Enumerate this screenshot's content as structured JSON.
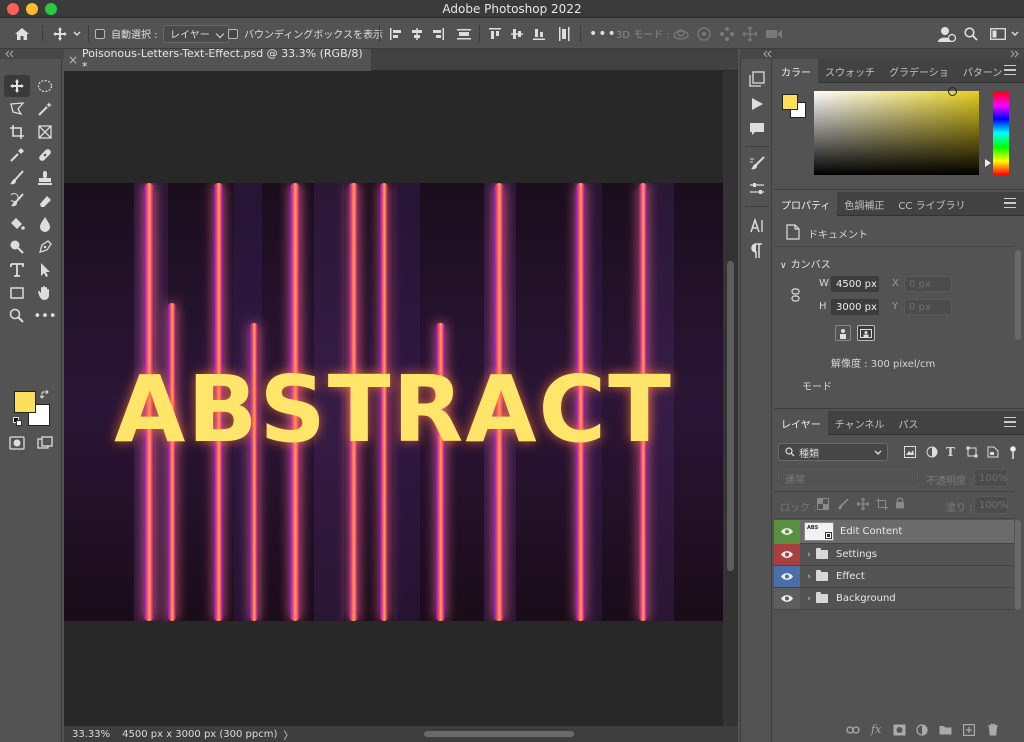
{
  "app": {
    "title": "Adobe Photoshop 2022"
  },
  "options_bar": {
    "auto_select_label": "自動選択 :",
    "auto_select_value": "レイヤー",
    "bounding_box_label": "バウンディングボックスを表示",
    "mode_3d_label": "3D モード :"
  },
  "document": {
    "tab_title": "Poisonous-Letters-Text-Effect.psd @ 33.3% (RGB/8) *",
    "artwork_text": "ABSTRACT"
  },
  "status": {
    "zoom": "33.33%",
    "doc_info": "4500 px x 3000 px (300 ppcm)",
    "more": "〉"
  },
  "colors": {
    "foreground": "#fedf5c",
    "background": "#ffffff",
    "accent_green": "#5a8f3e",
    "accent_red": "#a94040",
    "accent_blue": "#4a6ea8"
  },
  "color_panel": {
    "tabs": [
      "カラー",
      "スウォッチ",
      "グラデーショ",
      "パターン"
    ]
  },
  "properties_panel": {
    "tabs": [
      "プロパティ",
      "色調補正",
      "CC ライブラリ"
    ],
    "document_label": "ドキュメント",
    "canvas_section": "カンバス",
    "w_label": "W",
    "w_value": "4500 px",
    "h_label": "H",
    "h_value": "3000 px",
    "x_label": "X",
    "x_placeholder": "0 px",
    "y_label": "Y",
    "y_placeholder": "0 px",
    "resolution": "解像度 : 300 pixel/cm",
    "mode_label": "モード"
  },
  "layers_panel": {
    "tabs": [
      "レイヤー",
      "チャンネル",
      "パス"
    ],
    "filter_kind": "種類",
    "blend_mode": "通常",
    "opacity_label": "不透明度 :",
    "opacity_value": "100%",
    "lock_label": "ロック :",
    "fill_label": "塗り :",
    "fill_value": "100%",
    "layers": [
      {
        "name": "Edit Content",
        "kind": "smart-object",
        "color": "green",
        "thumb_text": "ABS"
      },
      {
        "name": "Settings",
        "kind": "group",
        "color": "red"
      },
      {
        "name": "Effect",
        "kind": "group",
        "color": "blue"
      },
      {
        "name": "Background",
        "kind": "group",
        "color": "none"
      }
    ]
  }
}
